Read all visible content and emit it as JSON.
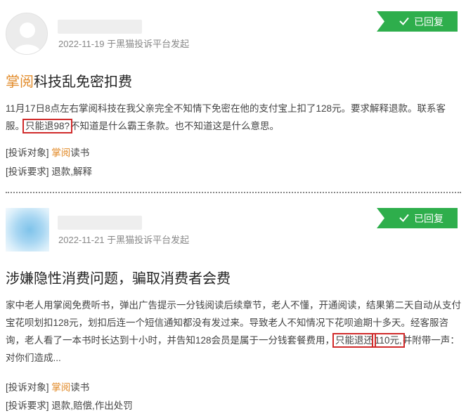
{
  "complaints": [
    {
      "date_line": "2022-11-19 于黑猫投诉平台发起",
      "status": "已回复",
      "title_brand": "掌阅",
      "title_rest": "科技乱免密扣费",
      "body_before": "11月17日8点左右掌阅科技在我父亲完全不知情下免密在他的支付宝上扣了128元。要求解释退款。联系客服。",
      "body_highlight": "只能退98?",
      "body_after": "不知道是什么霸王条款。也不知道这是什么意思。",
      "target_label": "[投诉对象]",
      "target_brand": "掌阅",
      "target_rest": "读书",
      "demand_label": "[投诉要求]",
      "demand_value": "退款,解释"
    },
    {
      "date_line": "2022-11-21 于黑猫投诉平台发起",
      "status": "已回复",
      "title": "涉嫌隐性消费问题，骗取消费者会费",
      "body_before": "家中老人用掌阅免费听书，弹出广告提示一分钱阅读后续章节，老人不懂，开通阅读，结果第二天自动从支付宝花呗划扣128元，划扣后连一个短信通知都没有发过来。导致老人不知情况下花呗逾期十多天。经客服咨询，老人看了一本书时长达到十小时，并告知128会员是属于一分钱套餐费用，",
      "body_highlight_1": "只能退还",
      "body_highlight_2": "110元,",
      "body_after": "并附带一声：对你们造成...",
      "target_label": "[投诉对象]",
      "target_brand": "掌阅",
      "target_rest": "读书",
      "demand_label": "[投诉要求]",
      "demand_value": "退款,赔偿,作出处罚"
    }
  ],
  "colors": {
    "replied_bg": "#2eae4c",
    "brand": "#e28b2a",
    "highlight_border": "#d02b2b"
  }
}
